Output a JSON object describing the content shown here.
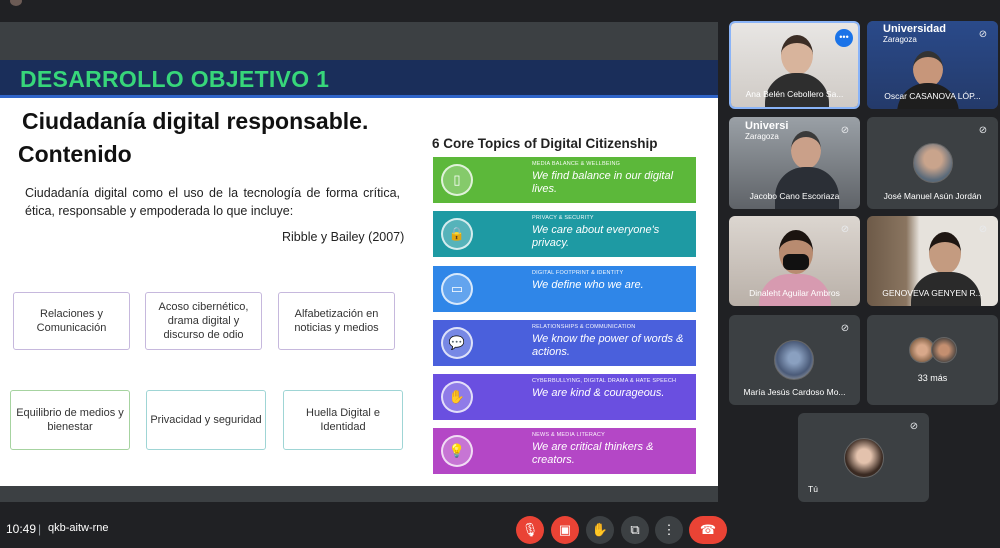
{
  "slide": {
    "header": "DESARROLLO OBJETIVO 1",
    "title_line1": "Ciudadanía digital responsable.",
    "title_line2": "Contenido",
    "definition": "Ciudadanía digital como el uso de la tecnología de forma crítica, ética, responsable y empoderada lo que incluye:",
    "citation": "Ribble y Bailey (2007)",
    "boxes": [
      "Relaciones y Comunicación",
      "Acoso cibernético, drama digital y discurso de odio",
      "Alfabetización en noticias y medios",
      "Equilibrio de medios y bienestar",
      "Privacidad y seguridad",
      "Huella Digital e Identidad"
    ],
    "core_title": "6 Core Topics of Digital Citizenship",
    "topics": [
      {
        "small": "MEDIA BALANCE & WELLBEING",
        "big": "We find balance in our digital lives.",
        "color": "#5cb83a",
        "icon": "phone-icon"
      },
      {
        "small": "PRIVACY & SECURITY",
        "big": "We care about everyone's privacy.",
        "color": "#1e9aa3",
        "icon": "lock-icon"
      },
      {
        "small": "DIGITAL FOOTPRINT & IDENTITY",
        "big": "We define who we are.",
        "color": "#2f86e8",
        "icon": "id-card-icon"
      },
      {
        "small": "RELATIONSHIPS & COMMUNICATION",
        "big": "We know the power of words & actions.",
        "color": "#4a60dc",
        "icon": "chat-icon"
      },
      {
        "small": "CYBERBULLYING, DIGITAL DRAMA & HATE SPEECH",
        "big": "We are kind & courageous.",
        "color": "#6a4fe0",
        "icon": "hands-icon"
      },
      {
        "small": "NEWS & MEDIA LITERACY",
        "big": "We are critical thinkers & creators.",
        "color": "#b447c6",
        "icon": "lightbulb-icon"
      }
    ]
  },
  "participants": [
    {
      "name": "Ana Belén Cebollero Sa..."
    },
    {
      "name": "Oscar CASANOVA LÓP...",
      "brand": "Universidad",
      "brand_sub": "Zaragoza"
    },
    {
      "name": "Jacobo Cano Escoriaza",
      "brand": "Universi",
      "brand_sub": "Zaragoza"
    },
    {
      "name": "José Manuel Asún Jordán"
    },
    {
      "name": "Dinaleht Aguilar Ambros"
    },
    {
      "name": "GENOVEVA GENYEN R..."
    },
    {
      "name": "María Jesús Cardoso Mo..."
    },
    {
      "name": "33 más"
    },
    {
      "name": "Tú"
    }
  ],
  "bottom": {
    "time": "10:49",
    "separator": "|",
    "meeting_code": "qkb-aitw-rne"
  },
  "colors": {
    "background": "#202124",
    "slide_header": "#1a2e5a",
    "header_text": "#37d67a",
    "end_call": "#ea4335",
    "accent": "#1a73e8"
  }
}
